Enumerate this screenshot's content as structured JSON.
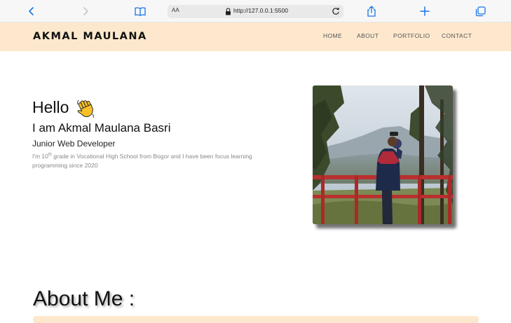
{
  "browser": {
    "url": "http://127.0.0.1:5500",
    "text_size_label": "AA",
    "icons": [
      "back-arrow-icon",
      "forward-arrow-icon",
      "bookmarks-icon",
      "lock-icon",
      "reload-icon",
      "share-icon",
      "plus-icon",
      "tabs-icon"
    ]
  },
  "navbar": {
    "brand": "AKMAL MAULANA",
    "links": [
      "HOME",
      "ABOUT",
      "PORTFOLIO",
      "CONTACT"
    ]
  },
  "hero": {
    "greeting": "Hello",
    "greeting_emoji": "waving-hand-icon",
    "name_line": "I am Akmal Maulana Basri",
    "role": "Junior Web Developer",
    "desc_prefix": "I'm 10",
    "desc_sup": "th",
    "desc_suffix": " grade in Vocational High School from Bogor and I have been focus learning programming since 2020"
  },
  "about": {
    "title": "About Me :"
  },
  "colors": {
    "navbar_bg": "#fde8cd",
    "accent_link": "#1a73e8"
  }
}
